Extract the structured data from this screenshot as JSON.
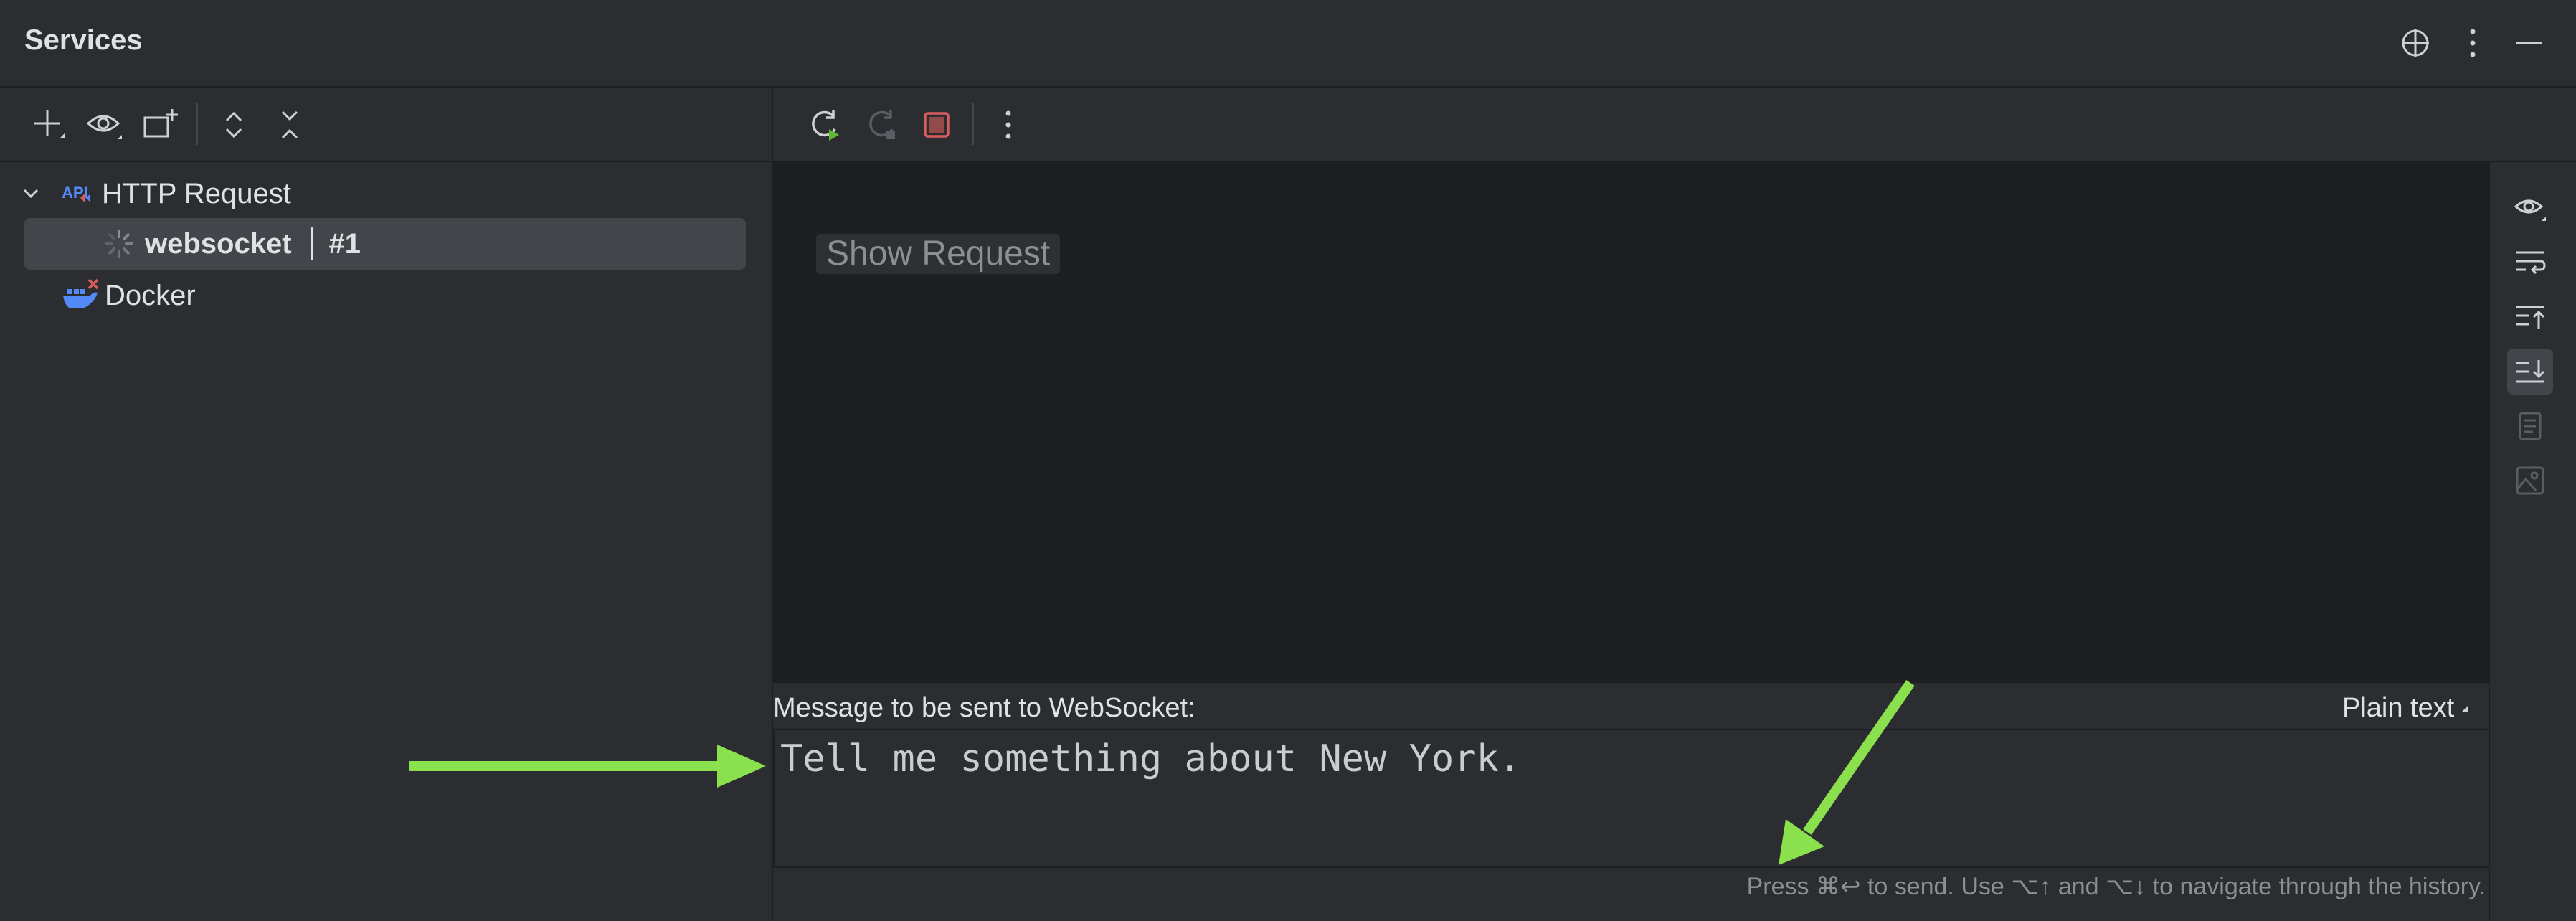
{
  "header": {
    "title": "Services"
  },
  "tree": {
    "items": [
      {
        "label": "HTTP Request"
      },
      {
        "label": "websocket",
        "suffix": "#1"
      },
      {
        "label": "Docker"
      }
    ]
  },
  "content": {
    "show_request_label": "Show Request"
  },
  "message": {
    "label": "Message to be sent to WebSocket:",
    "format": "Plain text",
    "value": "Tell me something about New York.",
    "hint": "Press ⌘↩ to send. Use ⌥↑ and ⌥↓ to navigate through the history."
  },
  "colors": {
    "background": "#2b2d30",
    "content_background": "#1e1f22",
    "selection": "#43454a",
    "annotation_arrow": "#8be04e",
    "stop_red": "#db5c5c",
    "run_green": "#5fb832",
    "api_icon_blue": "#548af7"
  },
  "icons": [
    "locate-icon",
    "more-icon",
    "minimize-icon",
    "add-icon",
    "eye-icon",
    "new-group-icon",
    "expand-all-icon",
    "collapse-all-icon",
    "chevron-down-icon",
    "api-icon",
    "spinner-icon",
    "docker-icon",
    "rerun-icon",
    "stop-icon",
    "soft-wrap-icon",
    "scroll-to-top-icon",
    "scroll-to-end-icon",
    "copy-icon",
    "image-icon"
  ]
}
